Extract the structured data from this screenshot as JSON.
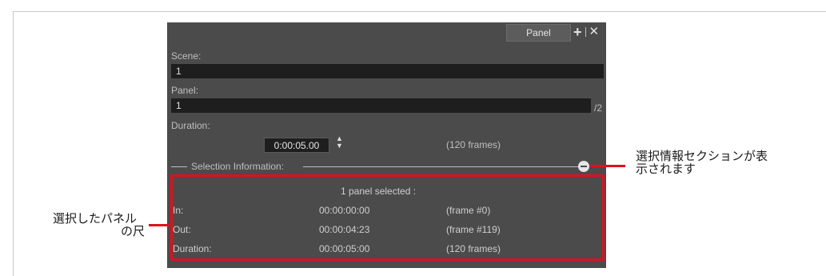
{
  "tab": {
    "label": "Panel"
  },
  "scene": {
    "label": "Scene:",
    "value": "1"
  },
  "panel": {
    "label": "Panel:",
    "value": "1",
    "total": "/2"
  },
  "duration": {
    "label": "Duration:",
    "value": "0:00:05.00",
    "frames": "(120 frames)"
  },
  "selection": {
    "title": "Selection Information:",
    "header": "1 panel selected :",
    "rows": [
      {
        "label": "In:",
        "time": "00:00:00:00",
        "frame": "(frame #0)"
      },
      {
        "label": "Out:",
        "time": "00:00:04:23",
        "frame": "(frame #119)"
      },
      {
        "label": "Duration:",
        "time": "00:00:05:00",
        "frame": "(120 frames)"
      }
    ]
  },
  "annotations": {
    "right_line1": "選択情報セクションが表",
    "right_line2": "示されます",
    "left_line1": "選択したパネル",
    "left_line2": "の尺"
  },
  "colors": {
    "panel_bg": "#4b4b4b",
    "field_bg": "#1e1e1e",
    "highlight": "#e0101e"
  }
}
